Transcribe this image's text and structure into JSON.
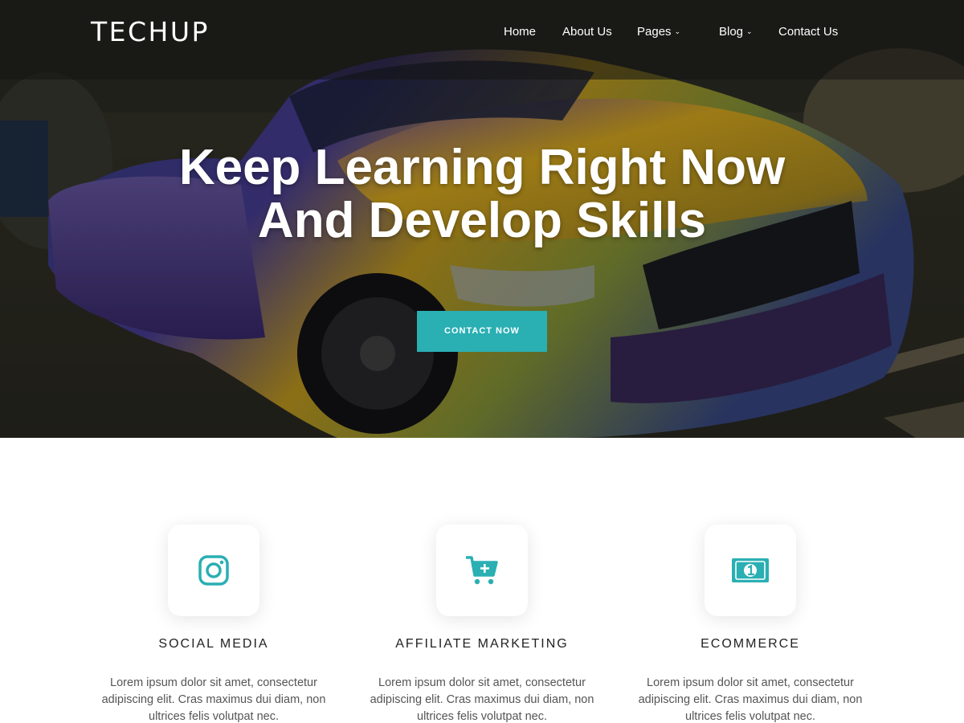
{
  "brand": {
    "logo": "TECHUP",
    "accent_color": "#2aafb3"
  },
  "nav": {
    "items": [
      {
        "label": "Home",
        "has_dropdown": false
      },
      {
        "label": "About Us",
        "has_dropdown": false
      },
      {
        "label": "Pages",
        "has_dropdown": true
      },
      {
        "label": "Blog",
        "has_dropdown": true
      },
      {
        "label": "Contact Us",
        "has_dropdown": false
      }
    ],
    "dropdown_icon": "chevron-down-icon"
  },
  "hero": {
    "title": "Keep Learning Right Now And Develop Skills",
    "cta_label": "CONTACT NOW",
    "background": "purple-gold-sports-car-photo"
  },
  "services": [
    {
      "icon": "instagram-icon",
      "title": "SOCIAL MEDIA",
      "text": "Lorem ipsum dolor sit amet, consectetur adipiscing elit. Cras maximus dui diam, non ultrices felis volutpat nec."
    },
    {
      "icon": "cart-plus-icon",
      "title": "AFFILIATE MARKETING",
      "text": "Lorem ipsum dolor sit amet, consectetur adipiscing elit. Cras maximus dui diam, non ultrices felis volutpat nec."
    },
    {
      "icon": "money-bill-icon",
      "title": "ECOMMERCE",
      "text": "Lorem ipsum dolor sit amet, consectetur adipiscing elit. Cras maximus dui diam, non ultrices felis volutpat nec."
    }
  ]
}
